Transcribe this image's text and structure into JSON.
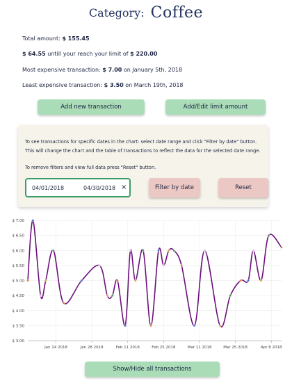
{
  "header": {
    "label": "Category:",
    "category": "Coffee"
  },
  "summary": {
    "total_label": "Total amount:",
    "total_value": "$ 155.45",
    "reach_value": "$ 64.55",
    "reach_text": "untill your reach your limit of",
    "limit_value": "$ 220.00",
    "most_label": "Most expensive transaction:",
    "most_value": "$ 7.00",
    "most_text": "on January 5th, 2018",
    "least_label": "Least expensive transaction:",
    "least_value": "$ 3.50",
    "least_text": "on March 19th, 2018"
  },
  "actions": {
    "add_label": "Add new transaction",
    "limit_label": "Add/Edit limit amount"
  },
  "filter": {
    "help1": "To see transactions for specific dates in the chart: select date range and click \"Filter by date\" button. This will change the chart and the table of transactions to reflect the data for the selected date range.",
    "help2": "To remove filters and view full data press \"Reset\" button.",
    "start_date": "04/01/2018",
    "end_date": "04/30/2018",
    "clear_glyph": "×",
    "filter_label": "Filter by date",
    "reset_label": "Reset"
  },
  "footer": {
    "toggle_label": "Show/Hide all transactions"
  },
  "colors": {
    "line": "#6b0f7a",
    "accent_green": "#a9dcb7",
    "accent_pink": "#ecc8c4",
    "title": "#233260",
    "panel_bg": "#f6f4ea"
  },
  "chart_data": {
    "type": "line",
    "title": "",
    "xlabel": "",
    "ylabel": "",
    "ylim": [
      3.0,
      7.0
    ],
    "yticks": [
      "$ 3.00",
      "$ 3.50",
      "$ 4.00",
      "$ 4.50",
      "$ 5.00",
      "$ 5.50",
      "$ 6.00",
      "$ 6.50",
      "$ 7.00"
    ],
    "xticks": [
      {
        "date": "2018-01-14",
        "label": "Jan 14 2018"
      },
      {
        "date": "2018-01-28",
        "label": "Jan 28 2018"
      },
      {
        "date": "2018-02-11",
        "label": "Feb 11 2018"
      },
      {
        "date": "2018-02-25",
        "label": "Feb 25 2018"
      },
      {
        "date": "2018-03-11",
        "label": "Mar 11 2018"
      },
      {
        "date": "2018-03-25",
        "label": "Mar 25 2018"
      },
      {
        "date": "2018-04-08",
        "label": "Apr 8 2018"
      }
    ],
    "xlim": [
      "2018-01-03",
      "2018-04-12"
    ],
    "grid": true,
    "series": [
      {
        "points": [
          {
            "x": "2018-01-03",
            "y": 5.0
          },
          {
            "x": "2018-01-05",
            "y": 7.0
          },
          {
            "x": "2018-01-08",
            "y": 4.5
          },
          {
            "x": "2018-01-10",
            "y": 5.0
          },
          {
            "x": "2018-01-13",
            "y": 6.0
          },
          {
            "x": "2018-01-17",
            "y": 4.25
          },
          {
            "x": "2018-01-24",
            "y": 5.0
          },
          {
            "x": "2018-01-31",
            "y": 5.5
          },
          {
            "x": "2018-02-03",
            "y": 4.5
          },
          {
            "x": "2018-02-05",
            "y": 4.5
          },
          {
            "x": "2018-02-07",
            "y": 5.0
          },
          {
            "x": "2018-02-10",
            "y": 3.5
          },
          {
            "x": "2018-02-12",
            "y": 6.0
          },
          {
            "x": "2018-02-14",
            "y": 5.0
          },
          {
            "x": "2018-02-17",
            "y": 6.0
          },
          {
            "x": "2018-02-20",
            "y": 3.5
          },
          {
            "x": "2018-02-23",
            "y": 6.0
          },
          {
            "x": "2018-02-25",
            "y": 5.5
          },
          {
            "x": "2018-02-27",
            "y": 6.0
          },
          {
            "x": "2018-03-01",
            "y": 6.0
          },
          {
            "x": "2018-03-04",
            "y": 5.5
          },
          {
            "x": "2018-03-09",
            "y": 3.5
          },
          {
            "x": "2018-03-13",
            "y": 6.0
          },
          {
            "x": "2018-03-19",
            "y": 3.5
          },
          {
            "x": "2018-03-23",
            "y": 4.5
          },
          {
            "x": "2018-03-27",
            "y": 5.0
          },
          {
            "x": "2018-03-30",
            "y": 5.0
          },
          {
            "x": "2018-04-01",
            "y": 6.0
          },
          {
            "x": "2018-04-04",
            "y": 5.0
          },
          {
            "x": "2018-04-07",
            "y": 6.5
          },
          {
            "x": "2018-04-12",
            "y": 6.1
          }
        ]
      }
    ]
  }
}
